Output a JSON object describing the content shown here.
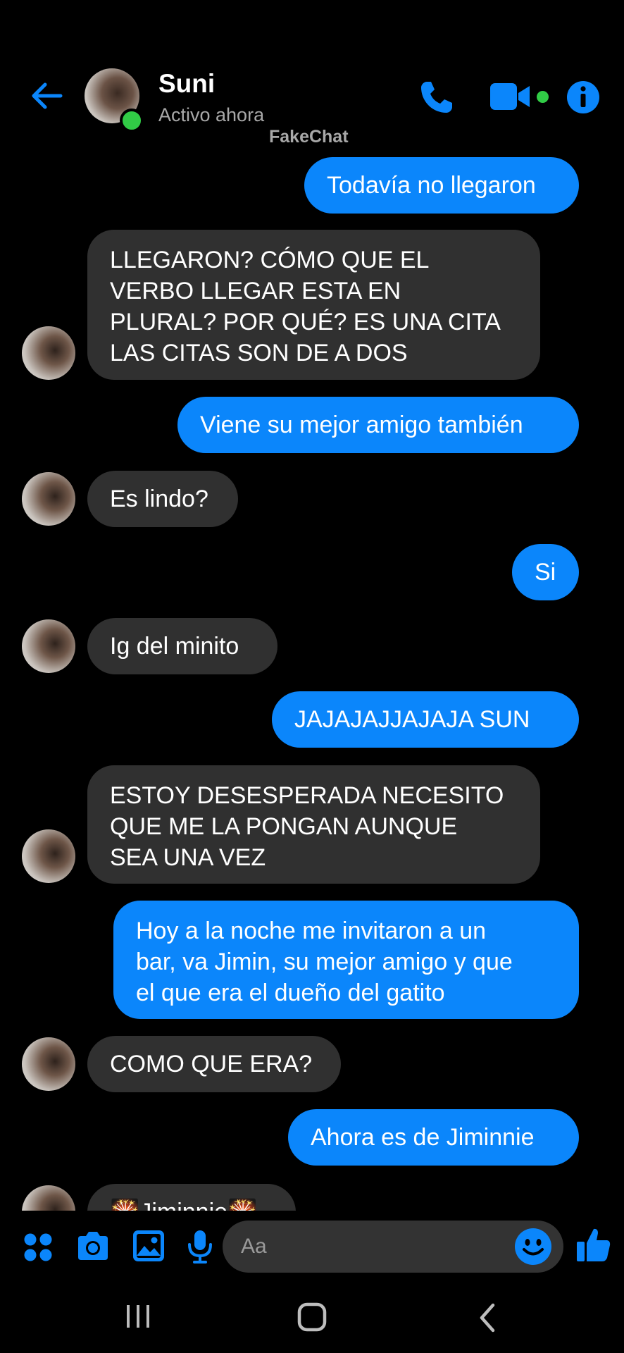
{
  "header": {
    "contact_name": "Suni",
    "status": "Activo ahora",
    "watermark": "FakeChat"
  },
  "colors": {
    "accent": "#0b86fb",
    "received_bubble": "#303030",
    "online": "#31cc46",
    "background": "#000000"
  },
  "icons": {
    "back": "arrow-left-icon",
    "call": "phone-icon",
    "video": "video-camera-icon",
    "info": "info-icon",
    "apps": "apps-grid-icon",
    "camera": "camera-icon",
    "gallery": "image-icon",
    "mic": "microphone-icon",
    "emoji": "smiley-icon",
    "like": "thumbs-up-icon"
  },
  "messages": [
    {
      "sender": "me",
      "text": "Todavía no llegaron"
    },
    {
      "sender": "Suni",
      "text": "LLEGARON? CÓMO QUE EL\nVERBO LLEGAR ESTA EN\nPLURAL? POR QUÉ? ES UNA CITA\nLAS CITAS SON DE A DOS"
    },
    {
      "sender": "me",
      "text": "Viene su mejor amigo también"
    },
    {
      "sender": "Suni",
      "text": "Es lindo?"
    },
    {
      "sender": "me",
      "text": "Si"
    },
    {
      "sender": "Suni",
      "text": "Ig del minito"
    },
    {
      "sender": "me",
      "text": "JAJAJAJJAJAJA SUN"
    },
    {
      "sender": "Suni",
      "text": "ESTOY DESESPERADA NECESITO\nQUE ME LA PONGAN AUNQUE\nSEA UNA VEZ"
    },
    {
      "sender": "me",
      "text": "Hoy a la noche me invitaron a un\nbar, va Jimin, su mejor amigo y que\nel que era el dueño del gatito"
    },
    {
      "sender": "Suni",
      "text": "COMO QUE ERA?"
    },
    {
      "sender": "me",
      "text": "Ahora es de Jiminnie"
    },
    {
      "sender": "Suni",
      "text": "🎇Jiminnie🎇"
    }
  ],
  "composer": {
    "placeholder": "Aa"
  },
  "navbar": {
    "recents": "recents-icon",
    "home": "home-icon",
    "back": "back-chevron-icon"
  }
}
